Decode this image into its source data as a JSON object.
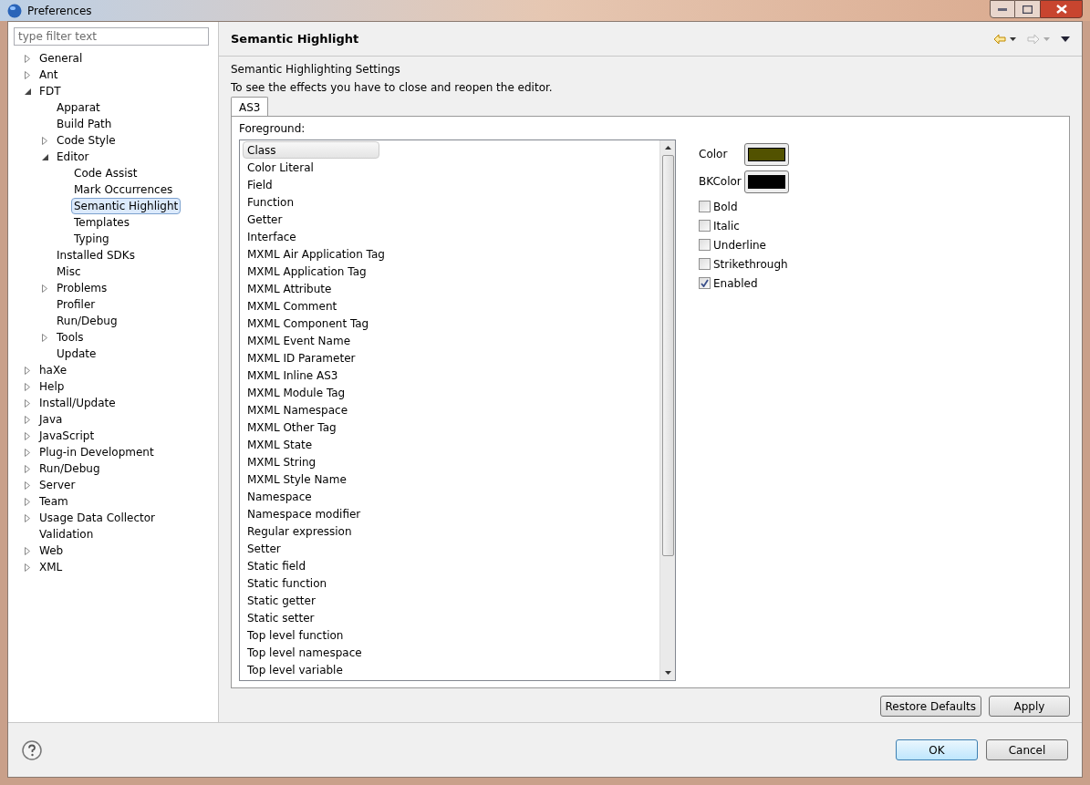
{
  "window": {
    "title": "Preferences"
  },
  "filter": {
    "placeholder": "type filter text"
  },
  "tree": [
    {
      "label": "General",
      "expanded": false,
      "selected": false
    },
    {
      "label": "Ant",
      "expanded": false,
      "selected": false
    },
    {
      "label": "FDT",
      "expanded": true,
      "selected": false,
      "children": [
        {
          "label": "Apparat",
          "selected": false
        },
        {
          "label": "Build Path",
          "selected": false
        },
        {
          "label": "Code Style",
          "expanded": false,
          "selected": false
        },
        {
          "label": "Editor",
          "expanded": true,
          "selected": false,
          "children": [
            {
              "label": "Code Assist",
              "selected": false
            },
            {
              "label": "Mark Occurrences",
              "selected": false
            },
            {
              "label": "Semantic Highlight",
              "selected": true
            },
            {
              "label": "Templates",
              "selected": false
            },
            {
              "label": "Typing",
              "selected": false
            }
          ]
        },
        {
          "label": "Installed SDKs",
          "selected": false
        },
        {
          "label": "Misc",
          "selected": false
        },
        {
          "label": "Problems",
          "expanded": false,
          "selected": false
        },
        {
          "label": "Profiler",
          "selected": false
        },
        {
          "label": "Run/Debug",
          "selected": false
        },
        {
          "label": "Tools",
          "expanded": false,
          "selected": false
        },
        {
          "label": "Update",
          "selected": false
        }
      ]
    },
    {
      "label": "haXe",
      "expanded": false,
      "selected": false
    },
    {
      "label": "Help",
      "expanded": false,
      "selected": false
    },
    {
      "label": "Install/Update",
      "expanded": false,
      "selected": false
    },
    {
      "label": "Java",
      "expanded": false,
      "selected": false
    },
    {
      "label": "JavaScript",
      "expanded": false,
      "selected": false
    },
    {
      "label": "Plug-in Development",
      "expanded": false,
      "selected": false
    },
    {
      "label": "Run/Debug",
      "expanded": false,
      "selected": false
    },
    {
      "label": "Server",
      "expanded": false,
      "selected": false
    },
    {
      "label": "Team",
      "expanded": false,
      "selected": false
    },
    {
      "label": "Usage Data Collector",
      "expanded": false,
      "selected": false
    },
    {
      "label": "Validation",
      "selected": false
    },
    {
      "label": "Web",
      "expanded": false,
      "selected": false
    },
    {
      "label": "XML",
      "expanded": false,
      "selected": false
    }
  ],
  "page": {
    "title": "Semantic Highlight",
    "heading": "Semantic Highlighting Settings",
    "note": "To see the effects you have to close and reopen the editor."
  },
  "tabs": [
    {
      "label": "AS3",
      "selected": true
    }
  ],
  "foreground_label": "Foreground:",
  "elements": [
    {
      "label": "Class",
      "selected": true
    },
    {
      "label": "Color Literal",
      "selected": false
    },
    {
      "label": "Field",
      "selected": false
    },
    {
      "label": "Function",
      "selected": false
    },
    {
      "label": "Getter",
      "selected": false
    },
    {
      "label": "Interface",
      "selected": false
    },
    {
      "label": "MXML Air Application Tag",
      "selected": false
    },
    {
      "label": "MXML Application Tag",
      "selected": false
    },
    {
      "label": "MXML Attribute",
      "selected": false
    },
    {
      "label": "MXML Comment",
      "selected": false
    },
    {
      "label": "MXML Component Tag",
      "selected": false
    },
    {
      "label": "MXML Event Name",
      "selected": false
    },
    {
      "label": "MXML ID Parameter",
      "selected": false
    },
    {
      "label": "MXML Inline AS3",
      "selected": false
    },
    {
      "label": "MXML Module Tag",
      "selected": false
    },
    {
      "label": "MXML Namespace",
      "selected": false
    },
    {
      "label": "MXML Other Tag",
      "selected": false
    },
    {
      "label": "MXML State",
      "selected": false
    },
    {
      "label": "MXML String",
      "selected": false
    },
    {
      "label": "MXML Style Name",
      "selected": false
    },
    {
      "label": "Namespace",
      "selected": false
    },
    {
      "label": "Namespace modifier",
      "selected": false
    },
    {
      "label": "Regular expression",
      "selected": false
    },
    {
      "label": "Setter",
      "selected": false
    },
    {
      "label": "Static field",
      "selected": false
    },
    {
      "label": "Static function",
      "selected": false
    },
    {
      "label": "Static getter",
      "selected": false
    },
    {
      "label": "Static setter",
      "selected": false
    },
    {
      "label": "Top level function",
      "selected": false
    },
    {
      "label": "Top level namespace",
      "selected": false
    },
    {
      "label": "Top level variable",
      "selected": false
    }
  ],
  "colors": [
    {
      "label": "Color",
      "color": "#525200"
    },
    {
      "label": "BKColor",
      "color": "#000000"
    }
  ],
  "options": [
    {
      "label": "Bold",
      "checked": false
    },
    {
      "label": "Italic",
      "checked": false
    },
    {
      "label": "Underline",
      "checked": false
    },
    {
      "label": "Strikethrough",
      "checked": false
    },
    {
      "label": "Enabled",
      "checked": true
    }
  ],
  "page_buttons": [
    "Restore Defaults",
    "Apply"
  ],
  "dialog_buttons": [
    {
      "label": "OK",
      "default": true
    },
    {
      "label": "Cancel",
      "default": false
    }
  ]
}
